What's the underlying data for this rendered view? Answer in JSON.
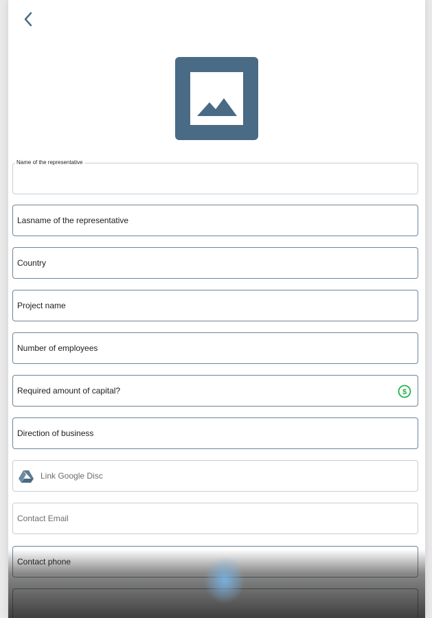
{
  "colors": {
    "brand": "#4a6b85",
    "accent_green": "#22b14c",
    "border": "#6f8494"
  },
  "header": {
    "back_icon": "chevron-left-icon"
  },
  "logo": {
    "icon": "image-placeholder-icon"
  },
  "form": {
    "fields": [
      {
        "label": "Name of the representative",
        "value": ""
      },
      {
        "label": "Lasname of the representative"
      },
      {
        "label": "Country"
      },
      {
        "label": "Project name"
      },
      {
        "label": "Number of employees"
      },
      {
        "label": "Required amount of capital?",
        "icon": "dollar-circle-icon"
      },
      {
        "label": "Direction of business"
      },
      {
        "label": "Link Google Disc",
        "icon": "google-drive-icon"
      },
      {
        "label": "Contact Email"
      },
      {
        "label": "Contact phone"
      },
      {
        "label": ""
      }
    ]
  }
}
